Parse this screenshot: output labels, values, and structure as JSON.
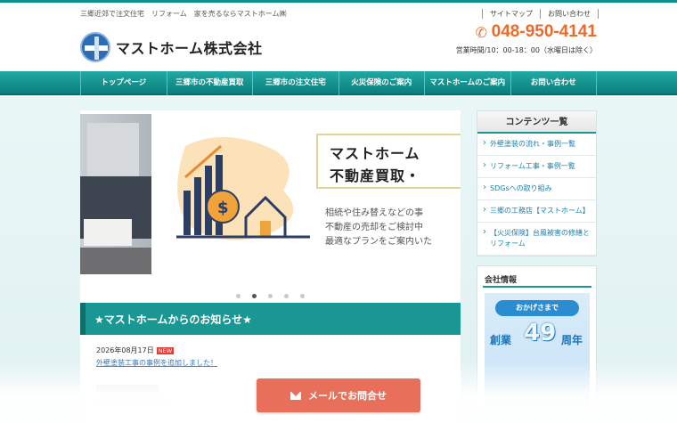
{
  "header": {
    "tagline": "三郷近郊で注文住宅　リフォーム　家を売るならマストホーム㈱",
    "company_name": "マストホーム株式会社",
    "top_links": [
      "サイトマップ",
      "お問い合わせ"
    ],
    "phone": "048-950-4141",
    "hours": "営業時間/10：00-18：00（水曜日は除く）"
  },
  "nav": {
    "items": [
      "トップページ",
      "三郷市の不動産買取",
      "三郷市の注文住宅",
      "火災保険のご案内",
      "マストホームのご案内",
      "お問い合わせ"
    ]
  },
  "slider": {
    "title_line1": "マストホーム",
    "title_line2": "不動産買取・",
    "copy_line1": "相続や住み替えなどの事",
    "copy_line2": "不動産の売却をご検討中",
    "copy_line3": "最適なプランをご案内いた"
  },
  "news": {
    "heading": "★マストホームからのお知らせ★",
    "items": [
      {
        "date": "2026年08月17日",
        "badge": "NEW",
        "text": "外壁塗装工事の事例を追加しました！"
      }
    ]
  },
  "sidebar": {
    "title": "コンテンツ一覧",
    "items": [
      "外壁塗装の流れ・事例一覧",
      "リフォーム工事・事例一覧",
      "SDGsへの取り組み",
      "三郷の工務店【マストホーム】",
      "【火災保険】台風被害の修繕とリフォーム"
    ],
    "company_title": "会社情報",
    "banner_top": "おかげさまで",
    "banner_left": "創業",
    "banner_num": "49",
    "banner_right": "周年"
  },
  "cta": {
    "mail_label": "メールでお問合せ"
  },
  "colors": {
    "accent": "#1a9793",
    "phone": "#ec6a2a",
    "cta": "#e8705a"
  }
}
